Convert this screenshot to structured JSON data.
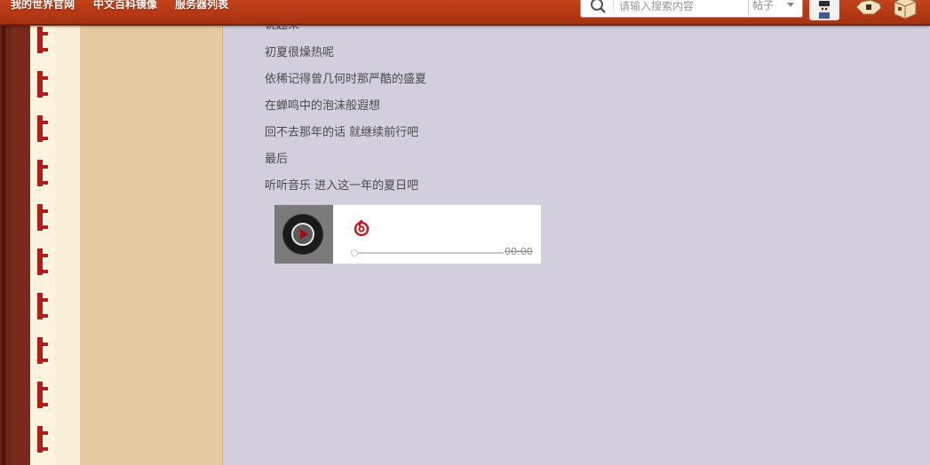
{
  "nav": {
    "links": [
      "我的世界官网",
      "中文百科镜像",
      "服务器列表"
    ]
  },
  "search": {
    "placeholder": "请输入搜索内容",
    "scope": "帖子"
  },
  "post": {
    "partial_top_line": "说起来",
    "lines": [
      "初夏很燥热呢",
      "依稀记得曾几何时那严酷的盛夏",
      "在蝉鸣中的泡沫般遐想",
      "回不去那年的话 就继续前行吧",
      "最后",
      "听听音乐 进入这一年的夏日吧"
    ]
  },
  "player": {
    "time": "00:00",
    "progress": 0
  },
  "colors": {
    "topbar": "#b83a14",
    "sidebar": "#e3caa0",
    "content_bg": "#d2cedd",
    "netease_red": "#c9141e"
  },
  "icons": [
    "search-icon",
    "chevron-down-icon",
    "avatar",
    "eye-icon",
    "box-icon",
    "play-icon",
    "netease-music-icon"
  ]
}
